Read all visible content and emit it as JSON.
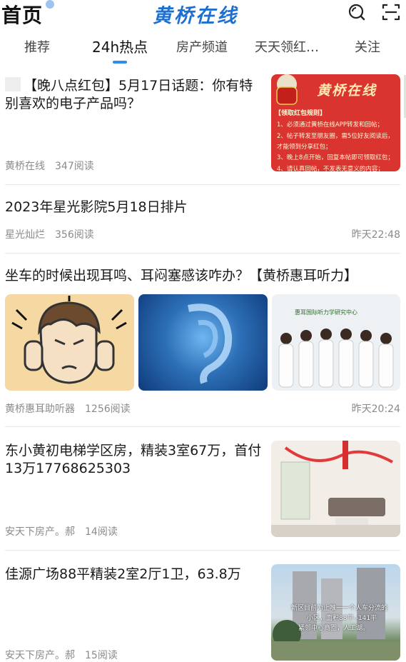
{
  "header": {
    "title": "首页",
    "brand": "黄桥在线",
    "search_icon": "search-icon",
    "scan_icon": "scan-icon"
  },
  "tabs": [
    {
      "label": "推荐",
      "active": false
    },
    {
      "label": "24h热点",
      "active": true
    },
    {
      "label": "房产频道",
      "active": false
    },
    {
      "label": "天天领红…",
      "active": false
    },
    {
      "label": "关注",
      "active": false
    }
  ],
  "colors": {
    "brand": "#1e6fd0",
    "tab_indicator": "#2c8cf0",
    "meta_text": "#8a8a8a"
  },
  "feed": [
    {
      "title": "【晚八点红包】5月17日话题：你有特别喜欢的电子产品吗？",
      "source": "黄桥在线",
      "reads": "347阅读",
      "time": "",
      "thumb_brand": "黄桥在线",
      "thumb_heading": "【领取红包规则】",
      "thumb_lines": [
        "1、必须通过黄桥在线APP转发和回帖；",
        "2、帖子转发至朋友圈，需5位好友阅读后，才能领到分享红包；",
        "3、晚上8点开始，回复本帖即可领取红包；",
        "4、请认真回帖，不发表无意义的内容；"
      ]
    },
    {
      "title": "2023年星光影院5月18日排片",
      "source": "星光灿烂",
      "reads": "356阅读",
      "time": "昨天22:48"
    },
    {
      "title": "坐车的时候出现耳鸣、耳闷塞感该咋办？【黄桥惠耳听力】",
      "source": "黄桥惠耳助听器",
      "reads": "1256阅读",
      "time": "昨天20:24",
      "thumb3_sign": "惠耳国际听力学研究中心"
    },
    {
      "title": "东小黄初电梯学区房，精装3室67万，首付13万17768625303",
      "source": "安天下房产。郝",
      "reads": "14阅读",
      "time": ""
    },
    {
      "title": "佳源广场88平精装2室2厅1卫，63.8万",
      "source": "安天下房产。郝",
      "reads": "15阅读",
      "time": "",
      "thumb_caption_1": "新区目前为止唯一一个人车分流的",
      "thumb_caption_2": "小区，面积88平--141平",
      "thumb_caption_3": "紧邻中心商圈，人工湖。"
    }
  ]
}
